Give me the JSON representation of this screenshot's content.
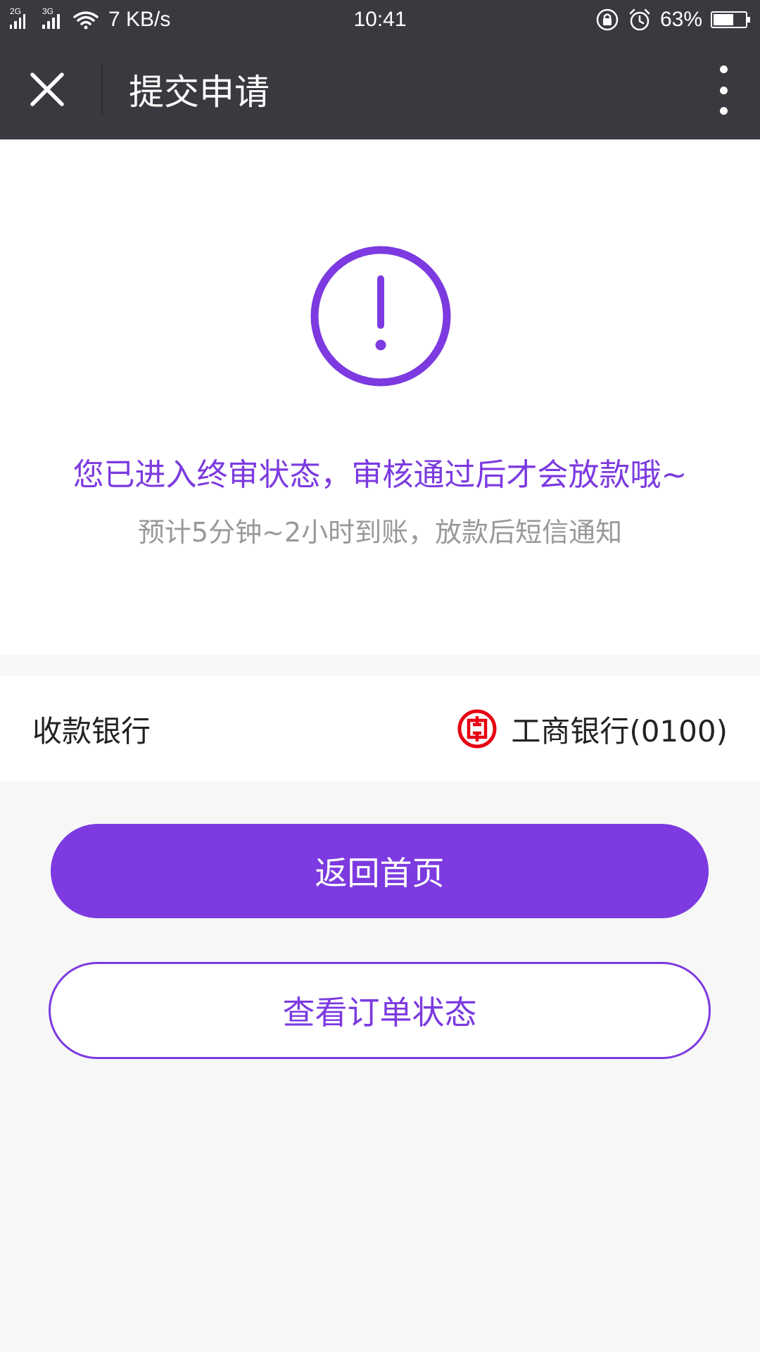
{
  "status_bar": {
    "network_1": "2G",
    "network_2": "3G",
    "speed": "7 KB/s",
    "time": "10:41",
    "battery_percent": "63%",
    "battery_level": 0.63
  },
  "header": {
    "title": "提交申请",
    "close_icon": "close-icon",
    "more_icon": "more-vertical-icon"
  },
  "status": {
    "icon": "exclamation-circle-icon",
    "title": "您已进入终审状态，审核通过后才会放款哦~",
    "subtitle": "预计5分钟~2小时到账，放款后短信通知"
  },
  "bank": {
    "label": "收款银行",
    "value": "工商银行(0100)",
    "icon": "icbc-logo-icon"
  },
  "actions": {
    "home_label": "返回首页",
    "order_status_label": "查看订单状态"
  },
  "colors": {
    "accent": "#7c3ae0",
    "header_bg": "#393a3f",
    "page_bg": "#f7f7f7",
    "subtitle": "#999999",
    "bank_logo": "#e60012"
  }
}
